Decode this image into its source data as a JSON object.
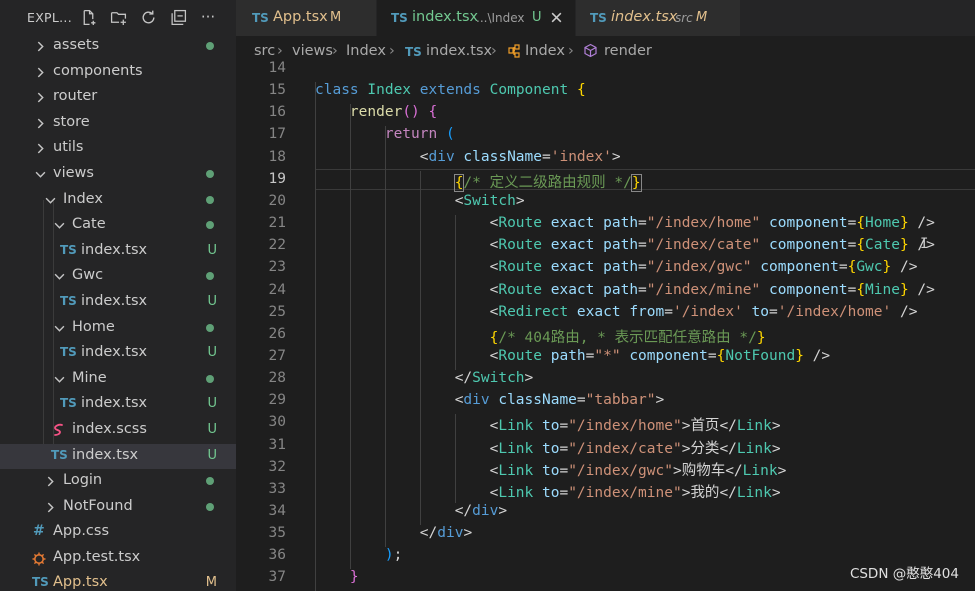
{
  "sidebar": {
    "title": "EXPL...",
    "actions": [
      "new-file-icon",
      "new-folder-icon",
      "refresh-icon",
      "collapse-all-icon",
      "more-icon"
    ],
    "more_label": "···",
    "items": [
      {
        "label": "assets",
        "type": "folder",
        "state": "collapsed",
        "git": "dot"
      },
      {
        "label": "components",
        "type": "folder",
        "state": "collapsed",
        "git": ""
      },
      {
        "label": "router",
        "type": "folder",
        "state": "collapsed",
        "git": ""
      },
      {
        "label": "store",
        "type": "folder",
        "state": "collapsed",
        "git": ""
      },
      {
        "label": "utils",
        "type": "folder",
        "state": "collapsed",
        "git": ""
      },
      {
        "label": "views",
        "type": "folder",
        "state": "expanded",
        "git": "dot"
      },
      {
        "label": "Index",
        "type": "folder",
        "state": "expanded",
        "git": "dot"
      },
      {
        "label": "Cate",
        "type": "folder",
        "state": "expanded",
        "git": "dot"
      },
      {
        "label": "index.tsx",
        "type": "ts",
        "git": "U"
      },
      {
        "label": "Gwc",
        "type": "folder",
        "state": "expanded",
        "git": "dot"
      },
      {
        "label": "index.tsx",
        "type": "ts",
        "git": "U"
      },
      {
        "label": "Home",
        "type": "folder",
        "state": "expanded",
        "git": "dot"
      },
      {
        "label": "index.tsx",
        "type": "ts",
        "git": "U"
      },
      {
        "label": "Mine",
        "type": "folder",
        "state": "expanded",
        "git": "dot"
      },
      {
        "label": "index.tsx",
        "type": "ts",
        "git": "U"
      },
      {
        "label": "index.scss",
        "type": "scss",
        "git": "U"
      },
      {
        "label": "index.tsx",
        "type": "ts",
        "git": "U",
        "selected": true
      },
      {
        "label": "Login",
        "type": "folder",
        "state": "collapsed",
        "git": "dot"
      },
      {
        "label": "NotFound",
        "type": "folder",
        "state": "collapsed",
        "git": "dot"
      },
      {
        "label": "App.css",
        "type": "css",
        "git": ""
      },
      {
        "label": "App.test.tsx",
        "type": "test",
        "git": ""
      },
      {
        "label": "App.tsx",
        "type": "ts",
        "git": "M"
      }
    ]
  },
  "tabs": [
    {
      "icon": "TS",
      "name": "App.tsx",
      "desc": "",
      "status": "M",
      "active": false
    },
    {
      "icon": "TS",
      "name": "index.tsx",
      "desc": "...\\Index",
      "status": "U",
      "active": true
    },
    {
      "icon": "TS",
      "name": "index.tsx",
      "desc": "src",
      "status": "M",
      "active": false
    }
  ],
  "breadcrumb": [
    "src",
    "views",
    "Index",
    "index.tsx",
    "Index",
    "render"
  ],
  "ts_label": "TS",
  "editor": {
    "current_line": 19,
    "lines": [
      {
        "n": 14,
        "tokens": []
      },
      {
        "n": 15,
        "tokens": [
          [
            "k",
            "class "
          ],
          [
            "c",
            "Index "
          ],
          [
            "k",
            "extends "
          ],
          [
            "c",
            "Component "
          ],
          [
            "b1",
            "{"
          ]
        ]
      },
      {
        "n": 16,
        "tokens": [
          [
            "p",
            "    "
          ],
          [
            "f",
            "render"
          ],
          [
            "b2",
            "()"
          ],
          [
            "p",
            " "
          ],
          [
            "b2",
            "{"
          ]
        ]
      },
      {
        "n": 17,
        "tokens": [
          [
            "p",
            "        "
          ],
          [
            "kc",
            "return "
          ],
          [
            "b3",
            "("
          ]
        ]
      },
      {
        "n": 18,
        "tokens": [
          [
            "p",
            "            "
          ],
          [
            "p",
            "<"
          ],
          [
            "t",
            "div "
          ],
          [
            "a",
            "className"
          ],
          [
            "p",
            "="
          ],
          [
            "s",
            "'index'"
          ],
          [
            "p",
            ">"
          ]
        ]
      },
      {
        "n": 19,
        "tokens": [
          [
            "p",
            "                "
          ],
          [
            "b1",
            "{"
          ],
          [
            "cm",
            "/* 定义二级路由规则 */"
          ],
          [
            "b1",
            "}"
          ]
        ]
      },
      {
        "n": 20,
        "tokens": [
          [
            "p",
            "                "
          ],
          [
            "p",
            "<"
          ],
          [
            "tg",
            "Switch"
          ],
          [
            "p",
            ">"
          ]
        ]
      },
      {
        "n": 21,
        "tokens": [
          [
            "p",
            "                    "
          ],
          [
            "p",
            "<"
          ],
          [
            "tg",
            "Route "
          ],
          [
            "a",
            "exact "
          ],
          [
            "a",
            "path"
          ],
          [
            "p",
            "="
          ],
          [
            "s",
            "\"/index/home\" "
          ],
          [
            "a",
            "component"
          ],
          [
            "p",
            "="
          ],
          [
            "b1",
            "{"
          ],
          [
            "c",
            "Home"
          ],
          [
            "b1",
            "}"
          ],
          [
            "p",
            " />"
          ]
        ]
      },
      {
        "n": 22,
        "tokens": [
          [
            "p",
            "                    "
          ],
          [
            "p",
            "<"
          ],
          [
            "tg",
            "Route "
          ],
          [
            "a",
            "exact "
          ],
          [
            "a",
            "path"
          ],
          [
            "p",
            "="
          ],
          [
            "s",
            "\"/index/cate\" "
          ],
          [
            "a",
            "component"
          ],
          [
            "p",
            "="
          ],
          [
            "b1",
            "{"
          ],
          [
            "c",
            "Cate"
          ],
          [
            "b1",
            "}"
          ],
          [
            "p",
            " />"
          ]
        ]
      },
      {
        "n": 23,
        "tokens": [
          [
            "p",
            "                    "
          ],
          [
            "p",
            "<"
          ],
          [
            "tg",
            "Route "
          ],
          [
            "a",
            "exact "
          ],
          [
            "a",
            "path"
          ],
          [
            "p",
            "="
          ],
          [
            "s",
            "\"/index/gwc\" "
          ],
          [
            "a",
            "component"
          ],
          [
            "p",
            "="
          ],
          [
            "b1",
            "{"
          ],
          [
            "c",
            "Gwc"
          ],
          [
            "b1",
            "}"
          ],
          [
            "p",
            " />"
          ]
        ]
      },
      {
        "n": 24,
        "tokens": [
          [
            "p",
            "                    "
          ],
          [
            "p",
            "<"
          ],
          [
            "tg",
            "Route "
          ],
          [
            "a",
            "exact "
          ],
          [
            "a",
            "path"
          ],
          [
            "p",
            "="
          ],
          [
            "s",
            "\"/index/mine\" "
          ],
          [
            "a",
            "component"
          ],
          [
            "p",
            "="
          ],
          [
            "b1",
            "{"
          ],
          [
            "c",
            "Mine"
          ],
          [
            "b1",
            "}"
          ],
          [
            "p",
            " />"
          ]
        ]
      },
      {
        "n": 25,
        "tokens": [
          [
            "p",
            "                    "
          ],
          [
            "p",
            "<"
          ],
          [
            "tg",
            "Redirect "
          ],
          [
            "a",
            "exact "
          ],
          [
            "a",
            "from"
          ],
          [
            "p",
            "="
          ],
          [
            "s",
            "'/index' "
          ],
          [
            "a",
            "to"
          ],
          [
            "p",
            "="
          ],
          [
            "s",
            "'/index/home' "
          ],
          [
            "p",
            "/>"
          ]
        ]
      },
      {
        "n": 26,
        "tokens": [
          [
            "p",
            "                    "
          ],
          [
            "b1",
            "{"
          ],
          [
            "cm",
            "/* 404路由, * 表示匹配任意路由 */"
          ],
          [
            "b1",
            "}"
          ]
        ]
      },
      {
        "n": 27,
        "tokens": [
          [
            "p",
            "                    "
          ],
          [
            "p",
            "<"
          ],
          [
            "tg",
            "Route "
          ],
          [
            "a",
            "path"
          ],
          [
            "p",
            "="
          ],
          [
            "s",
            "\"*\" "
          ],
          [
            "a",
            "component"
          ],
          [
            "p",
            "="
          ],
          [
            "b1",
            "{"
          ],
          [
            "c",
            "NotFound"
          ],
          [
            "b1",
            "}"
          ],
          [
            "p",
            " />"
          ]
        ]
      },
      {
        "n": 28,
        "tokens": [
          [
            "p",
            "                "
          ],
          [
            "p",
            "</"
          ],
          [
            "tg",
            "Switch"
          ],
          [
            "p",
            ">"
          ]
        ]
      },
      {
        "n": 29,
        "tokens": [
          [
            "p",
            "                "
          ],
          [
            "p",
            "<"
          ],
          [
            "t",
            "div "
          ],
          [
            "a",
            "className"
          ],
          [
            "p",
            "="
          ],
          [
            "s",
            "\"tabbar\""
          ],
          [
            "p",
            ">"
          ]
        ]
      },
      {
        "n": 30,
        "tokens": [
          [
            "p",
            "                    "
          ],
          [
            "p",
            "<"
          ],
          [
            "tg",
            "Link "
          ],
          [
            "a",
            "to"
          ],
          [
            "p",
            "="
          ],
          [
            "s",
            "\"/index/home\""
          ],
          [
            "p",
            ">"
          ],
          [
            "tx",
            "首页"
          ],
          [
            "p",
            "</"
          ],
          [
            "tg",
            "Link"
          ],
          [
            "p",
            ">"
          ]
        ]
      },
      {
        "n": 31,
        "tokens": [
          [
            "p",
            "                    "
          ],
          [
            "p",
            "<"
          ],
          [
            "tg",
            "Link "
          ],
          [
            "a",
            "to"
          ],
          [
            "p",
            "="
          ],
          [
            "s",
            "\"/index/cate\""
          ],
          [
            "p",
            ">"
          ],
          [
            "tx",
            "分类"
          ],
          [
            "p",
            "</"
          ],
          [
            "tg",
            "Link"
          ],
          [
            "p",
            ">"
          ]
        ]
      },
      {
        "n": 32,
        "tokens": [
          [
            "p",
            "                    "
          ],
          [
            "p",
            "<"
          ],
          [
            "tg",
            "Link "
          ],
          [
            "a",
            "to"
          ],
          [
            "p",
            "="
          ],
          [
            "s",
            "\"/index/gwc\""
          ],
          [
            "p",
            ">"
          ],
          [
            "tx",
            "购物车"
          ],
          [
            "p",
            "</"
          ],
          [
            "tg",
            "Link"
          ],
          [
            "p",
            ">"
          ]
        ]
      },
      {
        "n": 33,
        "tokens": [
          [
            "p",
            "                    "
          ],
          [
            "p",
            "<"
          ],
          [
            "tg",
            "Link "
          ],
          [
            "a",
            "to"
          ],
          [
            "p",
            "="
          ],
          [
            "s",
            "\"/index/mine\""
          ],
          [
            "p",
            ">"
          ],
          [
            "tx",
            "我的"
          ],
          [
            "p",
            "</"
          ],
          [
            "tg",
            "Link"
          ],
          [
            "p",
            ">"
          ]
        ]
      },
      {
        "n": 34,
        "tokens": [
          [
            "p",
            "                "
          ],
          [
            "p",
            "</"
          ],
          [
            "t",
            "div"
          ],
          [
            "p",
            ">"
          ]
        ]
      },
      {
        "n": 35,
        "tokens": [
          [
            "p",
            "            "
          ],
          [
            "p",
            "</"
          ],
          [
            "t",
            "div"
          ],
          [
            "p",
            ">"
          ]
        ]
      },
      {
        "n": 36,
        "tokens": [
          [
            "p",
            "        "
          ],
          [
            "b3",
            ")"
          ],
          [
            "p",
            ";"
          ]
        ]
      },
      {
        "n": 37,
        "tokens": [
          [
            "p",
            "    "
          ],
          [
            "b2",
            "}"
          ]
        ]
      }
    ]
  },
  "watermark": "CSDN @憨憨404",
  "colors": {
    "sidebar_bg": "#252526",
    "editor_bg": "#1e1e1e",
    "git_untracked": "#73c991",
    "git_modified": "#e2c08d",
    "ts_icon": "#519aba"
  }
}
